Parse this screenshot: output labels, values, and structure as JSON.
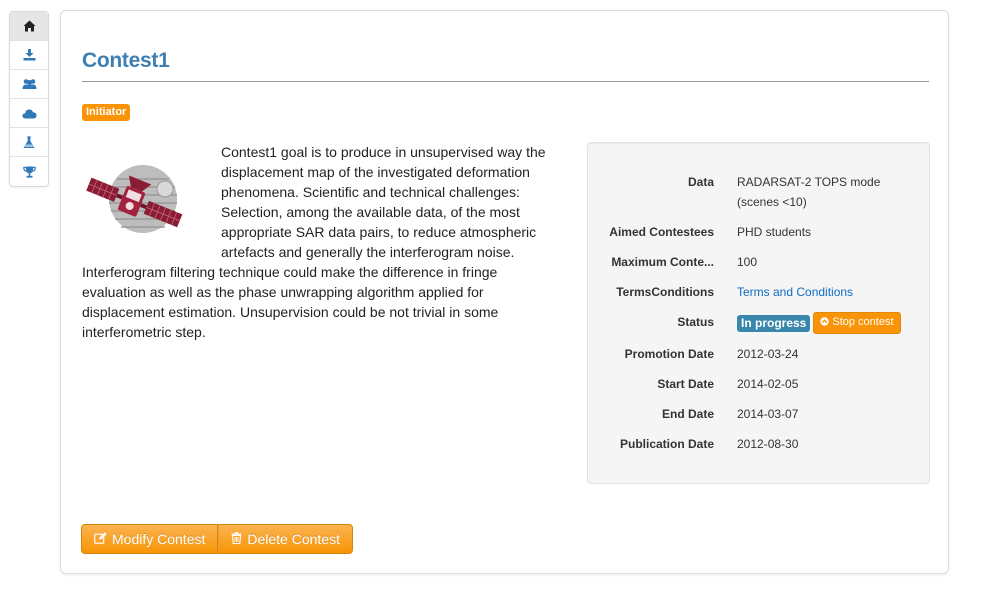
{
  "sidebar": {
    "items": [
      {
        "icon": "home-icon",
        "active": true
      },
      {
        "icon": "download-icon",
        "active": false
      },
      {
        "icon": "users-icon",
        "active": false
      },
      {
        "icon": "cloud-icon",
        "active": false
      },
      {
        "icon": "flask-icon",
        "active": false
      },
      {
        "icon": "trophy-icon",
        "active": false
      }
    ]
  },
  "contest": {
    "title": "Contest1",
    "role_badge": "Initiator",
    "description": "Contest1 goal is to produce in unsupervised way the displacement map of the investigated deformation phenomena. Scientific and technical challenges: Selection, among the available data, of the most appropriate SAR data pairs, to reduce atmospheric artefacts and generally the interferogram noise. Interferogram filtering technique could make the difference in fringe evaluation as well as the phase unwrapping algorithm applied for displacement estimation. Unsupervision could be not trivial in some interferometric step."
  },
  "details": {
    "data_label": "Data",
    "data_value": "RADARSAT-2 TOPS mode (scenes <10)",
    "aimed_label": "Aimed Contestees",
    "aimed_value": "PHD students",
    "max_label": "Maximum Conte...",
    "max_value": "100",
    "terms_label": "TermsConditions",
    "terms_value": "Terms and Conditions",
    "status_label": "Status",
    "status_value": "In progress",
    "stop_button": "Stop contest",
    "promotion_label": "Promotion Date",
    "promotion_value": "2012-03-24",
    "start_label": "Start Date",
    "start_value": "2014-02-05",
    "end_label": "End Date",
    "end_value": "2014-03-07",
    "publication_label": "Publication Date",
    "publication_value": "2012-08-30"
  },
  "actions": {
    "modify": "Modify Contest",
    "delete": "Delete Contest"
  },
  "colors": {
    "title": "#3d7fb1",
    "accent_orange": "#f89406",
    "status_blue": "#3a87ad",
    "link": "#0e6cc4"
  }
}
